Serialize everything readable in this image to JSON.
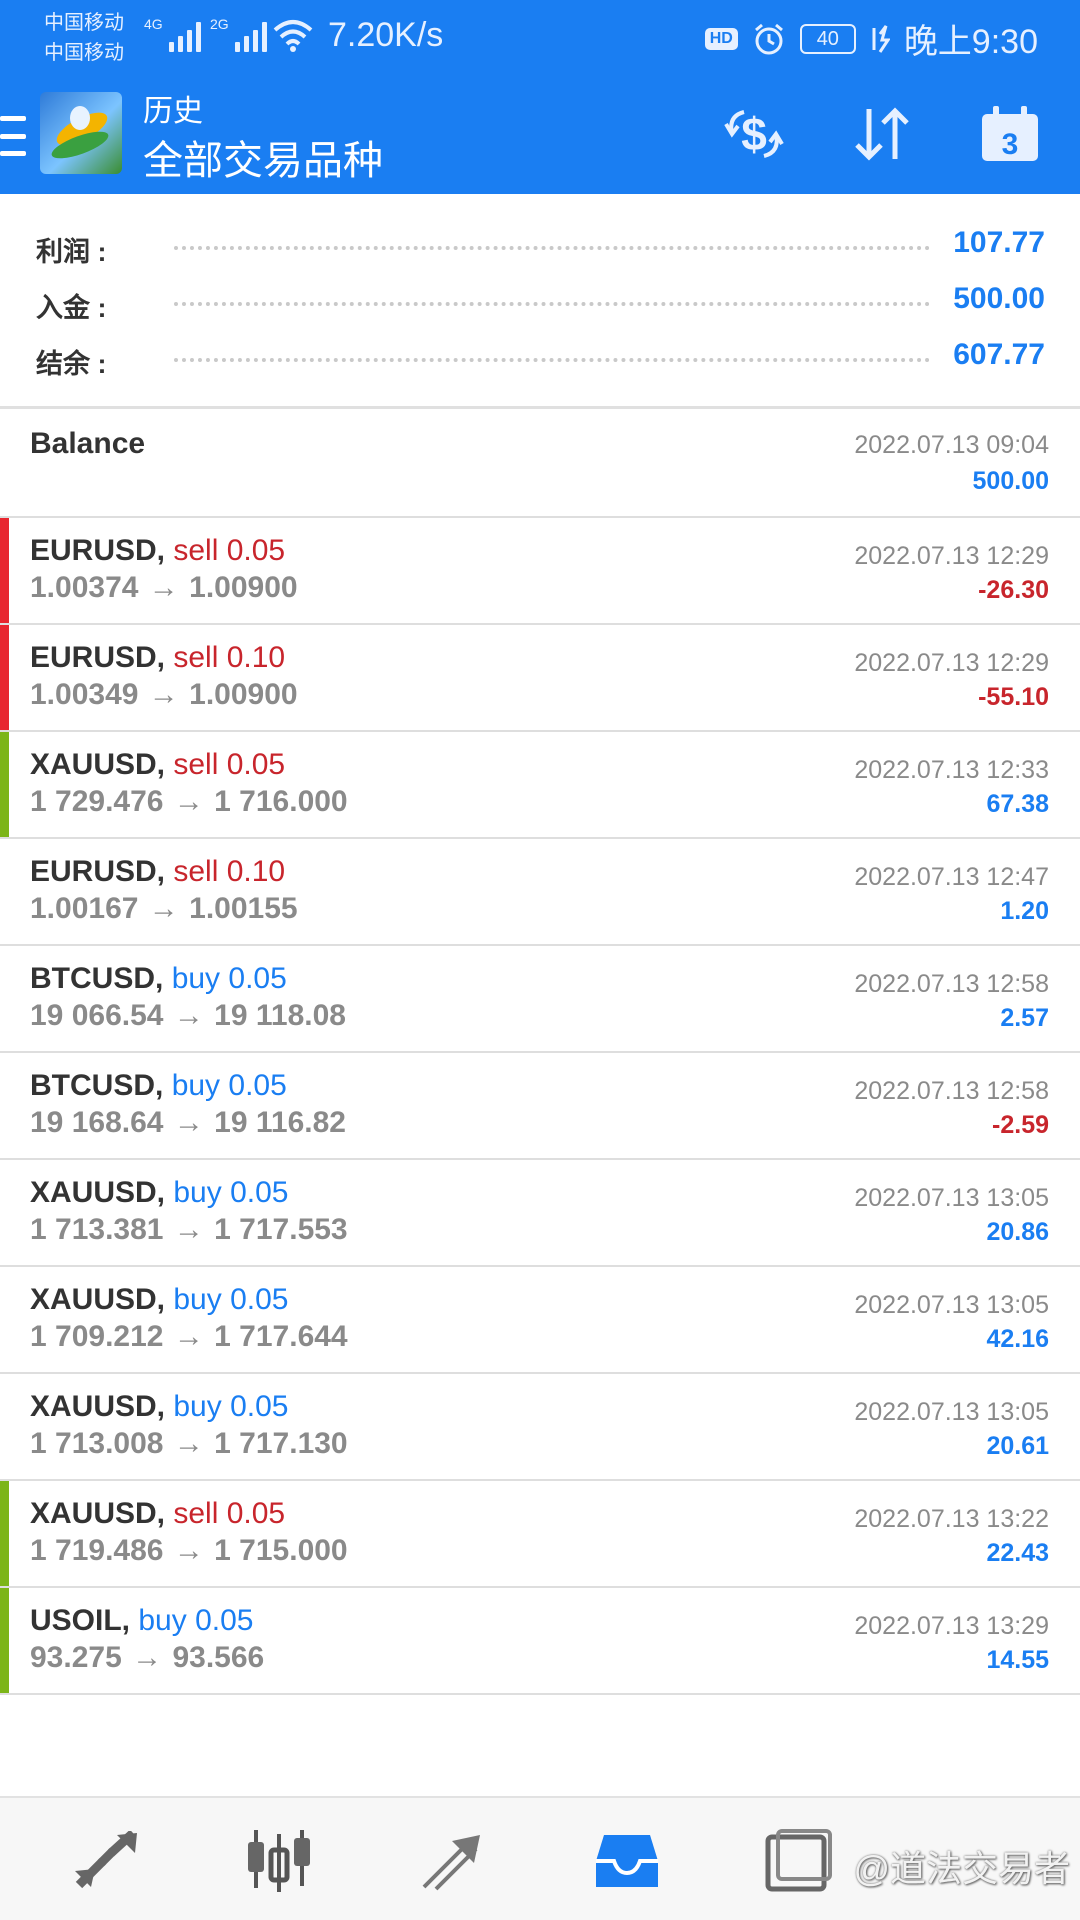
{
  "status_bar": {
    "carrier1": "中国移动",
    "carrier2": "中国移动",
    "net1": "4G",
    "net2": "2G",
    "speed": "7.20K/s",
    "hd": "HD",
    "battery": "40",
    "time": "晚上9:30"
  },
  "header": {
    "subtitle": "历史",
    "title": "全部交易品种",
    "calendar_day": "3"
  },
  "summary": {
    "rows": [
      {
        "label": "利润 :",
        "value": "107.77"
      },
      {
        "label": "入金 :",
        "value": "500.00"
      },
      {
        "label": "结余 :",
        "value": "607.77"
      }
    ]
  },
  "balance_entry": {
    "title": "Balance",
    "time": "2022.07.13 09:04",
    "amount": "500.00"
  },
  "trades": [
    {
      "symbol": "EURUSD,",
      "side": "sell 0.05",
      "open": "1.00374",
      "close": "1.00900",
      "time": "2022.07.13 12:29",
      "profit": "-26.30"
    },
    {
      "symbol": "EURUSD,",
      "side": "sell 0.10",
      "open": "1.00349",
      "close": "1.00900",
      "time": "2022.07.13 12:29",
      "profit": "-55.10"
    },
    {
      "symbol": "XAUUSD,",
      "side": "sell 0.05",
      "open": "1 729.476",
      "close": "1 716.000",
      "time": "2022.07.13 12:33",
      "profit": "67.38"
    },
    {
      "symbol": "EURUSD,",
      "side": "sell 0.10",
      "open": "1.00167",
      "close": "1.00155",
      "time": "2022.07.13 12:47",
      "profit": "1.20"
    },
    {
      "symbol": "BTCUSD,",
      "side": "buy 0.05",
      "open": "19 066.54",
      "close": "19 118.08",
      "time": "2022.07.13 12:58",
      "profit": "2.57"
    },
    {
      "symbol": "BTCUSD,",
      "side": "buy 0.05",
      "open": "19 168.64",
      "close": "19 116.82",
      "time": "2022.07.13 12:58",
      "profit": "-2.59"
    },
    {
      "symbol": "XAUUSD,",
      "side": "buy 0.05",
      "open": "1 713.381",
      "close": "1 717.553",
      "time": "2022.07.13 13:05",
      "profit": "20.86"
    },
    {
      "symbol": "XAUUSD,",
      "side": "buy 0.05",
      "open": "1 709.212",
      "close": "1 717.644",
      "time": "2022.07.13 13:05",
      "profit": "42.16"
    },
    {
      "symbol": "XAUUSD,",
      "side": "buy 0.05",
      "open": "1 713.008",
      "close": "1 717.130",
      "time": "2022.07.13 13:05",
      "profit": "20.61"
    },
    {
      "symbol": "XAUUSD,",
      "side": "sell 0.05",
      "open": "1 719.486",
      "close": "1 715.000",
      "time": "2022.07.13 13:22",
      "profit": "22.43"
    },
    {
      "symbol": "USOIL,",
      "side": "buy 0.05",
      "open": "93.275",
      "close": "93.566",
      "time": "2022.07.13 13:29",
      "profit": "14.55"
    }
  ],
  "arrow_glyph": "→",
  "markers": [
    "red",
    "red",
    "green",
    "none",
    "none",
    "none",
    "none",
    "none",
    "none",
    "green",
    "green"
  ],
  "colors": {
    "primary": "#1a7ef2",
    "sell": "#c8252c",
    "loss": "#c8252c",
    "marker_red": "#e8262f",
    "marker_green": "#7cb518"
  },
  "bottom_nav": {
    "items": [
      "quotes-icon",
      "chart-icon",
      "trade-icon",
      "history-icon",
      "news-icon"
    ],
    "active": "history-icon",
    "watermark": "@道法交易者"
  }
}
